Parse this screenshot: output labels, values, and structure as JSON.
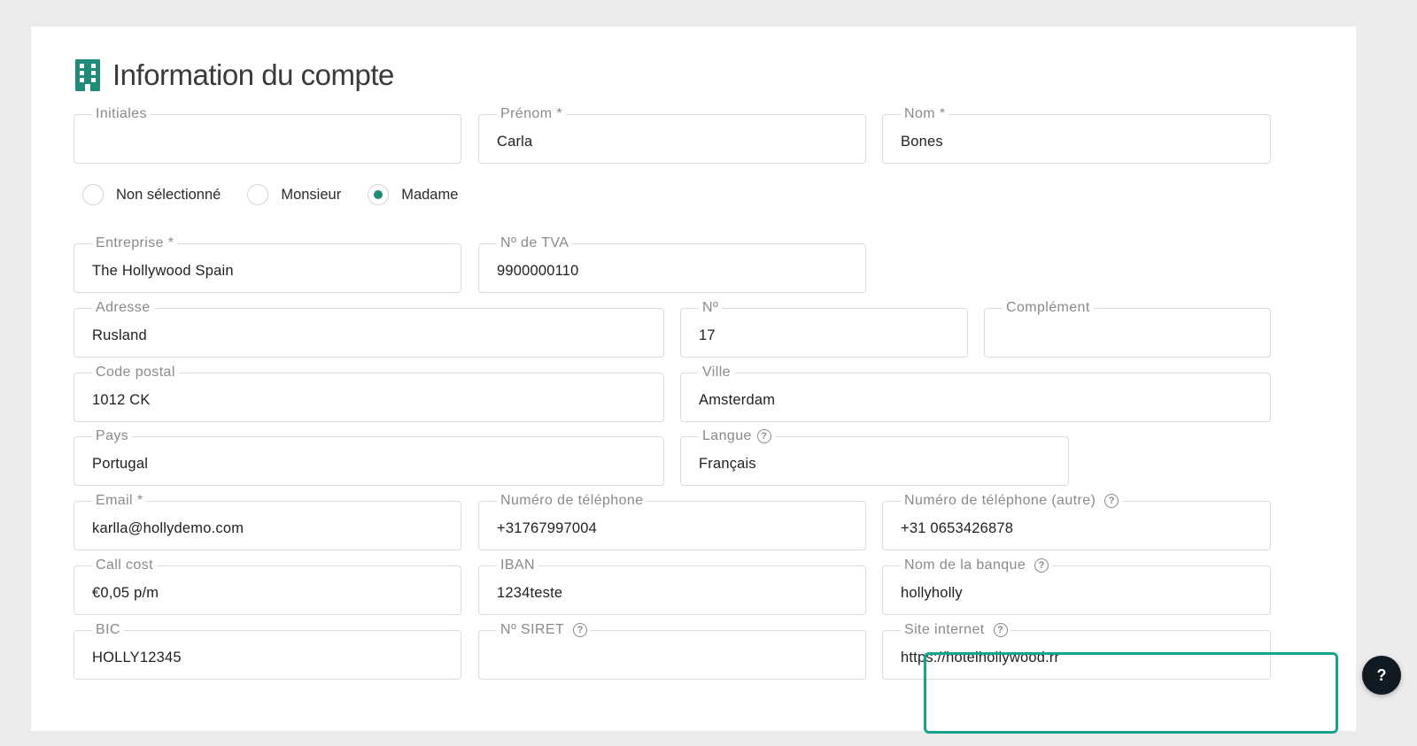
{
  "title": "Information du compte",
  "icons": {
    "title": "building-icon",
    "help": "question-circle-icon"
  },
  "colors": {
    "accent": "#15a58c",
    "icon": "#1e8c78",
    "fab": "#0f1a22"
  },
  "fields": {
    "initiales": {
      "label": "Initiales",
      "value": ""
    },
    "prenom": {
      "label": "Prénom *",
      "value": "Carla"
    },
    "nom": {
      "label": "Nom *",
      "value": "Bones"
    },
    "entreprise": {
      "label": "Entreprise *",
      "value": "The Hollywood Spain"
    },
    "tva": {
      "label": "Nº de TVA",
      "value": "9900000110"
    },
    "adresse": {
      "label": "Adresse",
      "value": "Rusland"
    },
    "numero": {
      "label": "Nº",
      "value": "17"
    },
    "complement": {
      "label": "Complément",
      "value": ""
    },
    "code_postal": {
      "label": "Code postal",
      "value": "1012 CK"
    },
    "ville": {
      "label": "Ville",
      "value": "Amsterdam"
    },
    "pays": {
      "label": "Pays",
      "value": "Portugal"
    },
    "langue": {
      "label": "Langue",
      "value": "Français"
    },
    "email": {
      "label": "Email *",
      "value": "karlla@hollydemo.com"
    },
    "telephone": {
      "label": "Numéro de téléphone",
      "value": "+31767997004"
    },
    "telephone_autre": {
      "label": "Numéro de téléphone (autre)",
      "value": "+31 0653426878"
    },
    "call_cost": {
      "label": "Call cost",
      "value": "€0,05 p/m"
    },
    "iban": {
      "label": "IBAN",
      "value": "1234teste"
    },
    "banque": {
      "label": "Nom de la banque",
      "value": "hollyholly"
    },
    "bic": {
      "label": "BIC",
      "value": "HOLLY12345"
    },
    "siret": {
      "label": "Nº SIRET",
      "value": ""
    },
    "site": {
      "label": "Site internet",
      "value": "https://hotelhollywood.rr"
    }
  },
  "civilite": {
    "options": [
      "Non sélectionné",
      "Monsieur",
      "Madame"
    ],
    "selected": "Madame"
  },
  "help_button": {
    "label": "?"
  }
}
